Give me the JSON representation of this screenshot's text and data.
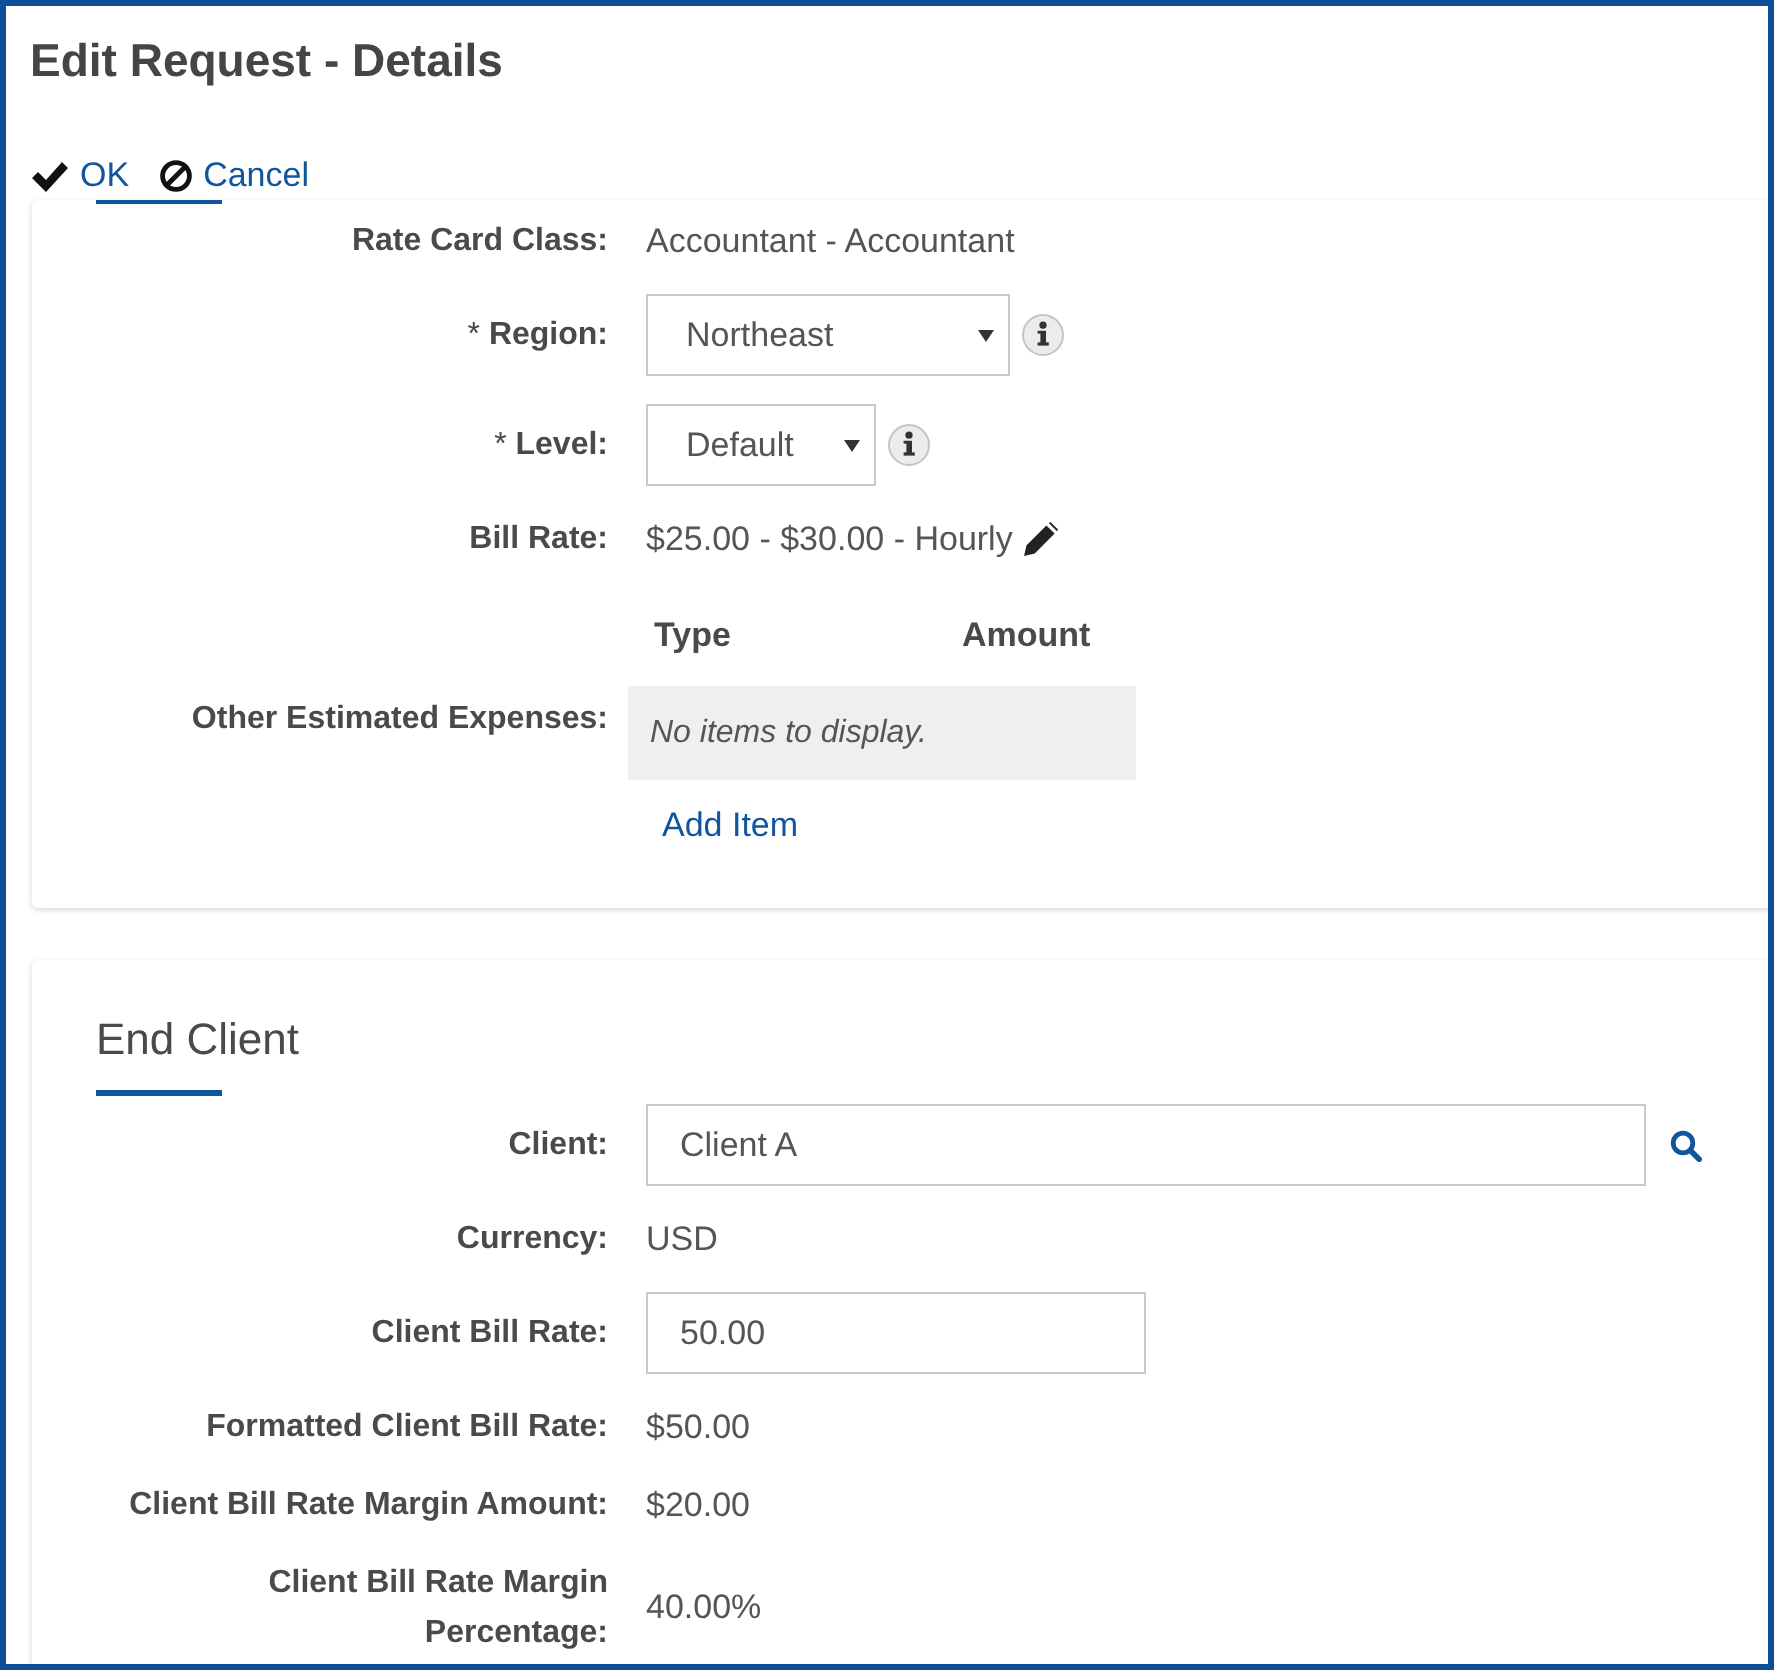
{
  "window": {
    "title": "Edit Request - Details"
  },
  "toolbar": [
    {
      "kind": "ok",
      "label": "OK"
    },
    {
      "kind": "cancel",
      "label": "Cancel"
    }
  ],
  "details": {
    "fields": [
      {
        "kind": "text",
        "label": "Rate Card Class:",
        "value": "Accountant - Accountant"
      },
      {
        "kind": "select",
        "required_mark": "*",
        "label": "Region:",
        "value": "Northeast",
        "info": true
      },
      {
        "kind": "select",
        "required_mark": "*",
        "label": "Level:",
        "value": "Default",
        "info": true
      },
      {
        "kind": "text",
        "label": "Bill Rate:",
        "value": "$25.00 - $30.00 - Hourly",
        "editable": true
      },
      {
        "kind": "table",
        "label": "Other Estimated Expenses:",
        "columns": [
          "Type",
          "Amount"
        ],
        "empty_message": "No items to display.",
        "add_link": "Add Item"
      }
    ]
  },
  "end_client": {
    "heading": "End Client",
    "fields": [
      {
        "kind": "input",
        "label": "Client:",
        "value": "Client A",
        "lookup": true
      },
      {
        "kind": "text",
        "label": "Currency:",
        "value": "USD"
      },
      {
        "kind": "input",
        "label": "Client Bill Rate:",
        "value": "50.00"
      },
      {
        "kind": "text",
        "label": "Formatted Client Bill Rate:",
        "value": "$50.00"
      },
      {
        "kind": "text",
        "label": "Client Bill Rate Margin Amount:",
        "value": "$20.00"
      },
      {
        "kind": "text",
        "label": "Client Bill Rate Margin Percentage:",
        "value": "40.00%"
      }
    ]
  }
}
